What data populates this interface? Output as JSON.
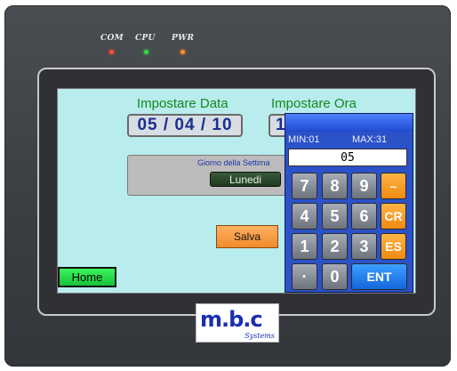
{
  "indicators": [
    {
      "label": "COM",
      "color": "#ff4a3c"
    },
    {
      "label": "CPU",
      "color": "#33dd44"
    },
    {
      "label": "PWR",
      "color": "#ff8a2a"
    }
  ],
  "screen": {
    "date_title": "Impostare Data",
    "time_title": "Impostare Ora",
    "date_value": "05 / 04 / 10",
    "time_value_partial": "1",
    "weekday_label": "Giorno della Settima",
    "weekday_value": "Lunedi",
    "save_label": "Salva",
    "home_label": "Home"
  },
  "keypad": {
    "min_label": "MIN:01",
    "max_label": "MAX:31",
    "entry_value": "05",
    "keys": {
      "k7": "7",
      "k8": "8",
      "k9": "9",
      "minus": "–",
      "k4": "4",
      "k5": "5",
      "k6": "6",
      "cr": "CR",
      "k1": "1",
      "k2": "2",
      "k3": "3",
      "es": "ES",
      "dot": "·",
      "k0": "0",
      "ent": "ENT"
    }
  },
  "logo": {
    "mark": "m.b.c",
    "sub": "Systems"
  }
}
